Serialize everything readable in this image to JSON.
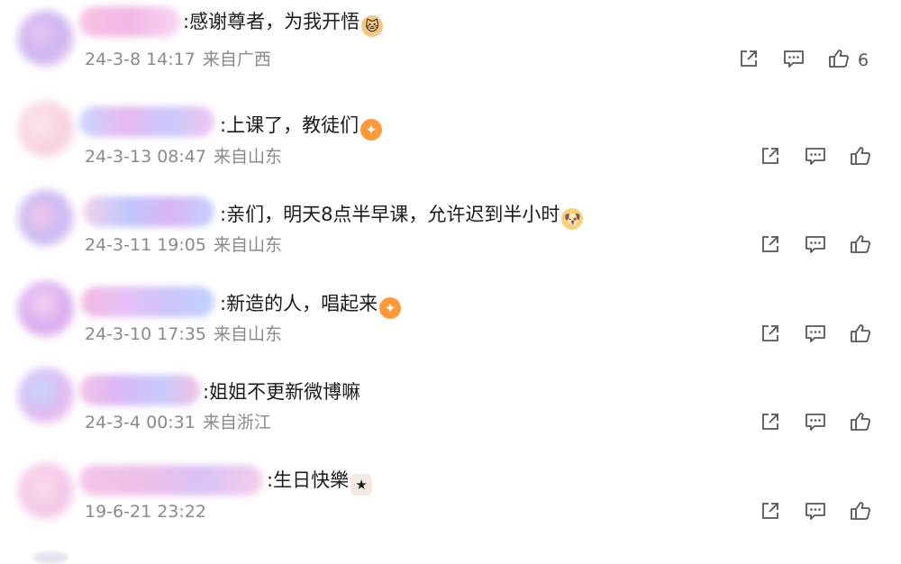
{
  "comments": [
    {
      "text": ":感谢尊者，为我开悟",
      "emoji": "cat-face",
      "date": "24-3-8 14:17",
      "location": "来自广西",
      "likes": "6"
    },
    {
      "text": ":上课了，教徒们",
      "emoji": "bird",
      "date": "24-3-13 08:47",
      "location": "来自山东",
      "likes": ""
    },
    {
      "text": ":亲们，明天8点半早课，允许迟到半小时",
      "emoji": "doge",
      "date": "24-3-11 19:05",
      "location": "来自山东",
      "likes": ""
    },
    {
      "text": ":新造的人，唱起来",
      "emoji": "bird",
      "date": "24-3-10 17:35",
      "location": "来自山东",
      "likes": ""
    },
    {
      "text": ":姐姐不更新微博嘛",
      "emoji": "",
      "date": "24-3-4 00:31",
      "location": "来自浙江",
      "likes": ""
    },
    {
      "text": ":生日快樂",
      "emoji": "cake",
      "date": "19-6-21 23:22",
      "location": "",
      "likes": ""
    }
  ],
  "icons": {
    "share": "share-icon",
    "comment": "comment-icon",
    "like": "thumbs-up-icon"
  },
  "colors": {
    "text": "#1b1b1b",
    "meta": "#8a8a8a",
    "icon": "#555555"
  }
}
